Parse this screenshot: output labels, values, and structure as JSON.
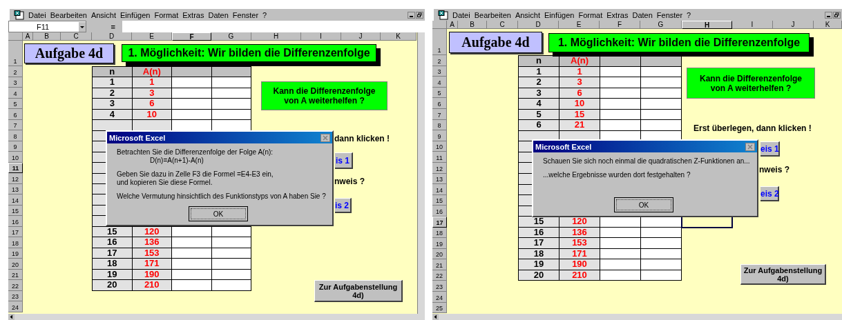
{
  "panels": [
    {
      "menu": [
        "Datei",
        "Bearbeiten",
        "Ansicht",
        "Einfügen",
        "Format",
        "Extras",
        "Daten",
        "Fenster",
        "?"
      ],
      "name_box": "F11",
      "formula_button": "=",
      "columns": [
        {
          "label": "A",
          "selected": false
        },
        {
          "label": "B",
          "selected": false
        },
        {
          "label": "C",
          "selected": false
        },
        {
          "label": "D",
          "selected": false
        },
        {
          "label": "E",
          "selected": false
        },
        {
          "label": "F",
          "selected": true
        },
        {
          "label": "G",
          "selected": false
        },
        {
          "label": "H",
          "selected": false
        },
        {
          "label": "I",
          "selected": false
        },
        {
          "label": "J",
          "selected": false
        },
        {
          "label": "K",
          "selected": false
        }
      ],
      "rows": [
        {
          "label": "1",
          "selected": false
        },
        {
          "label": "2",
          "selected": false
        },
        {
          "label": "3",
          "selected": false
        },
        {
          "label": "4",
          "selected": false
        },
        {
          "label": "5",
          "selected": false
        },
        {
          "label": "6",
          "selected": false
        },
        {
          "label": "7",
          "selected": false
        },
        {
          "label": "8",
          "selected": false
        },
        {
          "label": "9",
          "selected": false
        },
        {
          "label": "10",
          "selected": false
        },
        {
          "label": "11",
          "selected": true
        },
        {
          "label": "12",
          "selected": false
        },
        {
          "label": "13",
          "selected": false
        },
        {
          "label": "14",
          "selected": false
        },
        {
          "label": "15",
          "selected": false
        },
        {
          "label": "16",
          "selected": false
        },
        {
          "label": "17",
          "selected": false
        },
        {
          "label": "18",
          "selected": false
        },
        {
          "label": "19",
          "selected": false
        },
        {
          "label": "20",
          "selected": false
        },
        {
          "label": "21",
          "selected": false
        },
        {
          "label": "22",
          "selected": false
        },
        {
          "label": "23",
          "selected": false
        },
        {
          "label": "24",
          "selected": false
        }
      ],
      "title": "Aufgabe 4d",
      "heading": "1. Möglichkeit: Wir bilden die Differenzenfolge",
      "table": {
        "columns": [
          "n",
          "A(n)"
        ],
        "top_rows": [
          {
            "n": "1",
            "a": "1"
          },
          {
            "n": "2",
            "a": "3"
          },
          {
            "n": "3",
            "a": "6"
          },
          {
            "n": "4",
            "a": "10"
          }
        ],
        "bottom_rows": [
          {
            "n": "15",
            "a": "120"
          },
          {
            "n": "16",
            "a": "136"
          },
          {
            "n": "17",
            "a": "153"
          },
          {
            "n": "18",
            "a": "171"
          },
          {
            "n": "19",
            "a": "190"
          },
          {
            "n": "20",
            "a": "210"
          }
        ]
      },
      "question": [
        "Kann die Differenzenfolge",
        "von A weiterhelfen ?"
      ],
      "prompt": "dann klicken !",
      "hint_buttons": [
        "is 1",
        "is 2"
      ],
      "hint_question": "nweis ?",
      "back_button": [
        "Zur Aufgabenstellung",
        "4d)"
      ],
      "dialog": {
        "title": "Microsoft Excel",
        "paragraphs": [
          [
            {
              "text": "Betrachten Sie die Differenzenfolge der Folge A(n):",
              "indented": false
            },
            {
              "text": "D(n)=A(n+1)-A(n)",
              "indented": true
            }
          ],
          [
            {
              "text": "Geben Sie dazu in Zelle F3 die Formel =E4-E3 ein,",
              "indented": false
            },
            {
              "text": "und kopieren Sie diese Formel.",
              "indented": false
            }
          ],
          [
            {
              "text": "Welche Vermutung hinsichtlich des Funktionstyps von A haben Sie ?",
              "indented": false
            }
          ]
        ],
        "ok_button": "OK"
      }
    },
    {
      "menu": [
        "Datei",
        "Bearbeiten",
        "Ansicht",
        "Einfügen",
        "Format",
        "Extras",
        "Daten",
        "Fenster",
        "?"
      ],
      "columns": [
        {
          "label": "A",
          "selected": false
        },
        {
          "label": "B",
          "selected": false
        },
        {
          "label": "C",
          "selected": false
        },
        {
          "label": "D",
          "selected": false
        },
        {
          "label": "E",
          "selected": false
        },
        {
          "label": "F",
          "selected": false
        },
        {
          "label": "G",
          "selected": false
        },
        {
          "label": "H",
          "selected": true
        },
        {
          "label": "I",
          "selected": false
        },
        {
          "label": "J",
          "selected": false
        },
        {
          "label": "K",
          "selected": false
        }
      ],
      "rows": [
        {
          "label": "1",
          "selected": false
        },
        {
          "label": "2",
          "selected": false
        },
        {
          "label": "3",
          "selected": false
        },
        {
          "label": "4",
          "selected": false
        },
        {
          "label": "5",
          "selected": false
        },
        {
          "label": "6",
          "selected": false
        },
        {
          "label": "7",
          "selected": false
        },
        {
          "label": "8",
          "selected": false
        },
        {
          "label": "9",
          "selected": false
        },
        {
          "label": "10",
          "selected": false
        },
        {
          "label": "11",
          "selected": false
        },
        {
          "label": "12",
          "selected": false
        },
        {
          "label": "13",
          "selected": false
        },
        {
          "label": "14",
          "selected": false
        },
        {
          "label": "15",
          "selected": false
        },
        {
          "label": "16",
          "selected": false
        },
        {
          "label": "17",
          "selected": true
        },
        {
          "label": "18",
          "selected": false
        },
        {
          "label": "19",
          "selected": false
        },
        {
          "label": "20",
          "selected": false
        },
        {
          "label": "21",
          "selected": false
        },
        {
          "label": "22",
          "selected": false
        },
        {
          "label": "23",
          "selected": false
        },
        {
          "label": "24",
          "selected": false
        },
        {
          "label": "25",
          "selected": false
        }
      ],
      "title": "Aufgabe 4d",
      "heading": "1. Möglichkeit: Wir bilden die Differenzenfolge",
      "table": {
        "columns": [
          "n",
          "A(n)"
        ],
        "top_rows": [
          {
            "n": "1",
            "a": "1"
          },
          {
            "n": "2",
            "a": "3"
          },
          {
            "n": "3",
            "a": "6"
          },
          {
            "n": "4",
            "a": "10"
          },
          {
            "n": "5",
            "a": "15"
          },
          {
            "n": "6",
            "a": "21"
          }
        ],
        "bottom_rows": [
          {
            "n": "15",
            "a": "120"
          },
          {
            "n": "16",
            "a": "136"
          },
          {
            "n": "17",
            "a": "153"
          },
          {
            "n": "18",
            "a": "171"
          },
          {
            "n": "19",
            "a": "190"
          },
          {
            "n": "20",
            "a": "210"
          }
        ]
      },
      "question": [
        "Kann die Differenzenfolge",
        "von A weiterhelfen ?"
      ],
      "prompt": "Erst überlegen, dann klicken !",
      "hint_buttons": [
        "eis 1",
        "eis 2"
      ],
      "hint_question": "nweis ?",
      "back_button": [
        "Zur Aufgabenstellung",
        "4d)"
      ],
      "dialog": {
        "title": "Microsoft Excel",
        "paragraphs": [
          [
            {
              "text": "Schauen Sie sich noch einmal die quadratischen Z-Funktionen an...",
              "indented": false
            }
          ],
          [
            {
              "text": "...welche Ergebnisse wurden dort festgehalten ?",
              "indented": false
            }
          ]
        ],
        "ok_button": "OK"
      }
    }
  ]
}
